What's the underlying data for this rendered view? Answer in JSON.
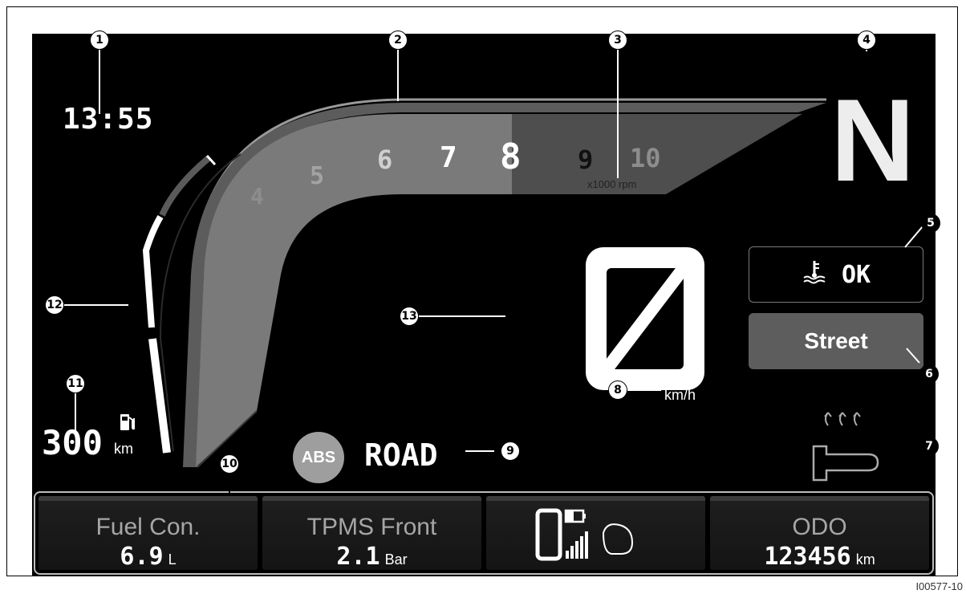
{
  "dashboard": {
    "clock": "13:55",
    "gear": "N",
    "speed": "0",
    "speed_unit": "km/h",
    "rpm_unit": "x1000 rpm",
    "rpm_ticks": [
      "4",
      "5",
      "6",
      "7",
      "8",
      "9",
      "10"
    ],
    "coolant_status": "OK",
    "riding_mode": "Street",
    "abs_label": "ABS",
    "abs_mode": "ROAD",
    "range_value": "300",
    "range_unit": "km"
  },
  "bottom_panels": [
    {
      "label": "Fuel Con.",
      "value": "6.9",
      "unit": "L"
    },
    {
      "label": "TPMS Front",
      "value": "2.1",
      "unit": "Bar"
    },
    {
      "label": "",
      "value": "",
      "unit": ""
    },
    {
      "label": "ODO",
      "value": "123456",
      "unit": "km"
    }
  ],
  "callouts": [
    "1",
    "2",
    "3",
    "4",
    "5",
    "6",
    "7",
    "8",
    "9",
    "10",
    "11",
    "12",
    "13"
  ],
  "figure_code": "I00577-10",
  "colors": {
    "screen_bg": "#000000",
    "gauge_fill": "#7a7a7a",
    "gauge_dark": "#4e4e4e",
    "mode_box": "#5d5d5d"
  },
  "icons": [
    "coolant-temp-icon",
    "fuel-pump-icon",
    "phone-icon",
    "battery-icon",
    "signal-bars-icon",
    "helmet-icon",
    "grip-heater-icon"
  ]
}
